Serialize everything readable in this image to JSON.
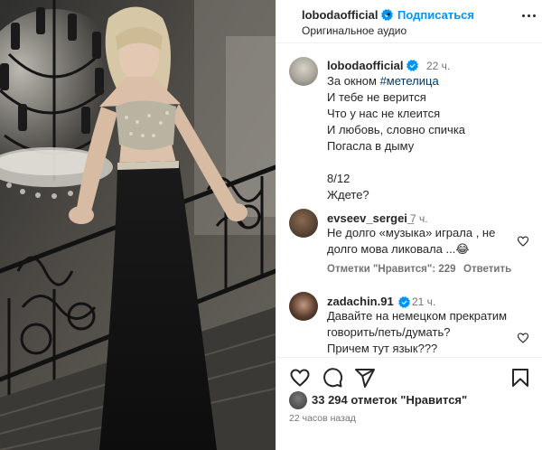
{
  "post": {
    "username": "lobodaofficial",
    "dot": "•",
    "follow_label": "Подписаться",
    "audio_label": "Оригинальное аудио"
  },
  "caption": {
    "username": "lobodaofficial",
    "time": "22 ч.",
    "line1_prefix": "За окном ",
    "hashtag": "#метелица",
    "body": "И тебе не верится\nЧто у нас не клеится\nИ любовь, словно спичка\nПогасла в дыму\n\n8/12\nЖдете?"
  },
  "comments": [
    {
      "username": "evseev_sergei_",
      "time": "7 ч.",
      "text": "Не долго «музыка» играла , не\nдолго мова ликовала ...😂",
      "likes_label": "Отметки \"Нравится\": 229",
      "reply_label": "Ответить"
    },
    {
      "username": "zadachin.91",
      "time": "21 ч.",
      "text": "Давайте на немецком прекратим\nговорить/петь/думать?\nПричем тут язык???"
    }
  ],
  "footer": {
    "likes_text": "33 294 отметок \"Нравится\"",
    "posted_time": "22 часов назад"
  },
  "icons": {
    "like": "heart-icon",
    "comment": "comment-icon",
    "share": "share-icon",
    "save": "bookmark-icon",
    "more": "more-options-icon",
    "verified": "verified-badge-icon"
  },
  "colors": {
    "accent": "#0095f6",
    "verified": "#0095f6",
    "hashtag": "#00376b",
    "secondary_text": "#737373"
  }
}
